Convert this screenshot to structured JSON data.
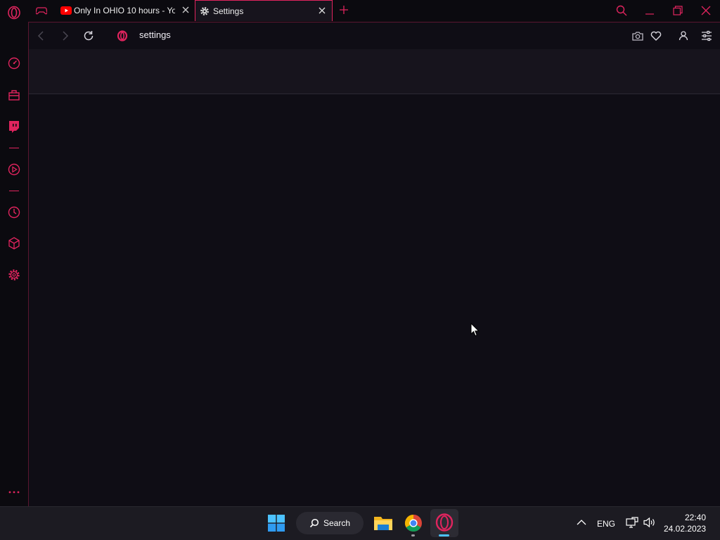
{
  "browser": {
    "tabs": [
      {
        "label": "Only In OHIO 10 hours - Yo",
        "icon": "youtube-icon"
      },
      {
        "label": "Settings",
        "icon": "gear-icon"
      }
    ],
    "address": {
      "url": "settings"
    },
    "accent": "#e0245e"
  },
  "sidebar": {
    "items": [
      "speed-dial-icon",
      "bag-icon",
      "twitch-icon",
      "player-icon",
      "history-icon",
      "extensions-icon",
      "settings-icon",
      "more-icon"
    ]
  },
  "taskbar": {
    "search_label": "Search",
    "language": "ENG",
    "time": "22:40",
    "date": "24.02.2023"
  }
}
